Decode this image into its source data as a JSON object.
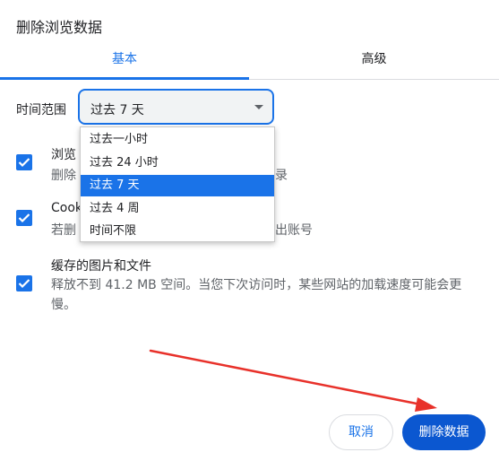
{
  "dialog": {
    "title": "删除浏览数据"
  },
  "tabs": [
    {
      "label": "基本",
      "active": true
    },
    {
      "label": "高级",
      "active": false
    }
  ],
  "time_range": {
    "label": "时间范围",
    "selected": "过去 7 天",
    "options": [
      "过去一小时",
      "过去 24 小时",
      "过去 7 天",
      "过去 4 周",
      "时间不限"
    ],
    "selected_index": 2
  },
  "options": [
    {
      "title_visible": "浏览",
      "desc_left": "删除",
      "desc_right": "录",
      "checked": true
    },
    {
      "title_visible": "Cook",
      "desc_left": "若删",
      "desc_right": "出账号",
      "checked": true
    },
    {
      "title": "缓存的图片和文件",
      "desc": "释放不到 41.2 MB 空间。当您下次访问时，某些网站的加载速度可能会更慢。",
      "checked": true
    }
  ],
  "buttons": {
    "cancel": "取消",
    "delete": "删除数据"
  },
  "colors": {
    "accent": "#1a73e8",
    "primary_button": "#0b57d0",
    "annotation_arrow": "#e8312a"
  }
}
